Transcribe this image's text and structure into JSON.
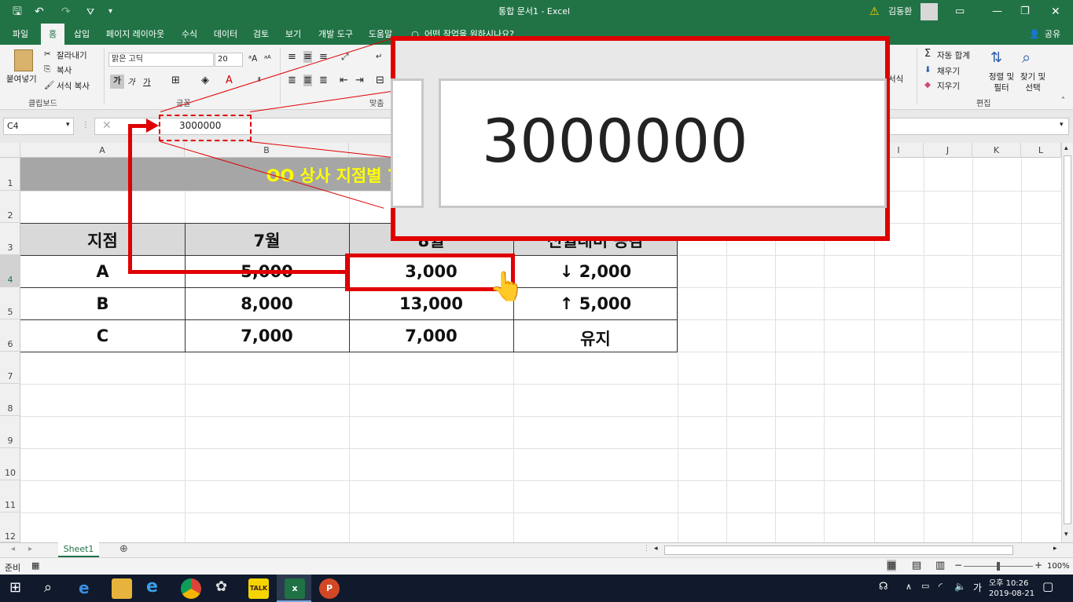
{
  "window": {
    "title": "통합 문서1  -  Excel",
    "user": "김동환"
  },
  "tabs": [
    "파일",
    "홈",
    "삽입",
    "페이지 레이아웃",
    "수식",
    "데이터",
    "검토",
    "보기",
    "개발 도구",
    "도움말"
  ],
  "tell_me": "어떤 작업을 원하시나요?",
  "share": "공유",
  "ribbon": {
    "paste": "붙여넣기",
    "cut": "잘라내기",
    "copy": "복사",
    "format_painter": "서식 복사",
    "clipboard": "클립보드",
    "font_name": "맑은 고딕",
    "font_size": "20",
    "bold": "가",
    "italic": "가",
    "underline": "가",
    "font_group": "글꼴",
    "align_group": "맞춤",
    "autosum": "자동 합계",
    "fill": "채우기",
    "clear": "지우기",
    "sort_filter": "정렬 및 필터",
    "find_select": "찾기 및 선택",
    "edit_group": "편집",
    "format_label": "서식"
  },
  "formula": {
    "namebox": "C4",
    "value": "3000000",
    "zoom_value": "3000000"
  },
  "columns": [
    "A",
    "B",
    "",
    "",
    "",
    "",
    "",
    "",
    "",
    "I",
    "J",
    "K",
    "L"
  ],
  "rows": [
    "1",
    "2",
    "3",
    "4",
    "5",
    "6",
    "7",
    "8",
    "9",
    "10",
    "11",
    "12"
  ],
  "sheet": {
    "title": "OO 상사 지점별 7,8월",
    "headers": [
      "지점",
      "7월",
      "8월",
      "전월대비 증감"
    ],
    "data": [
      [
        "A",
        "5,000",
        "3,000",
        "↓ 2,000"
      ],
      [
        "B",
        "8,000",
        "13,000",
        "↑ 5,000"
      ],
      [
        "C",
        "7,000",
        "7,000",
        "유지"
      ]
    ]
  },
  "sheet_tab": "Sheet1",
  "status": {
    "ready": "준비",
    "zoom": "100%"
  },
  "taskbar": {
    "ampm": "오후 10:26",
    "date": "2019-08-21",
    "ime": "가"
  },
  "colors": {
    "excel_green": "#217346",
    "highlight_red": "#e00000",
    "title_fill": "#a6a6a6",
    "title_text": "#ffff00",
    "header_fill": "#d9d9d9"
  }
}
